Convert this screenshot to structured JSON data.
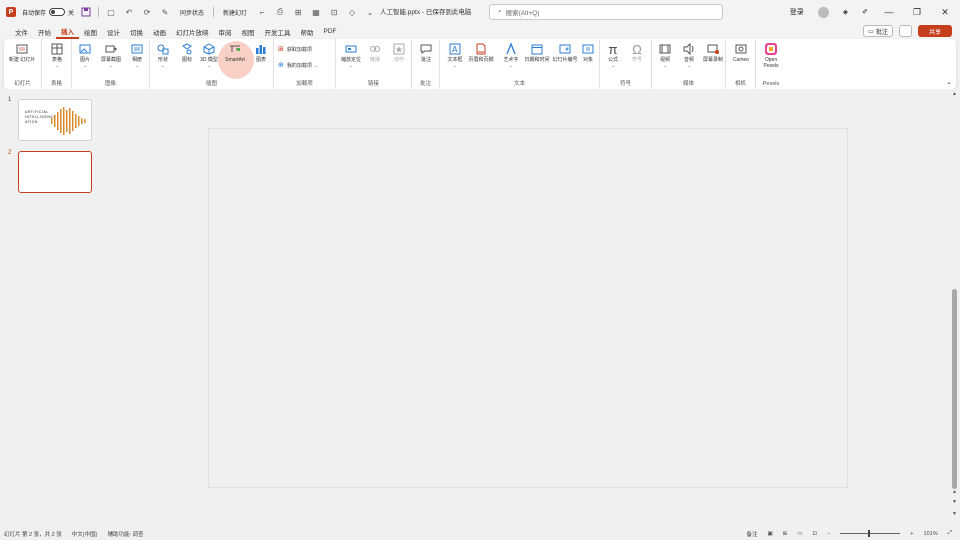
{
  "titlebar": {
    "autosave_label": "自动保存",
    "autosave_state": "关",
    "quick_text_1": "同步状态",
    "quick_text_2": "新建幻灯",
    "filename": "人工智能.pptx - 已保存到此电脑",
    "search_placeholder": "搜索(Alt+Q)",
    "user_name": "登录"
  },
  "menu": {
    "tabs": [
      "文件",
      "开始",
      "插入",
      "绘图",
      "设计",
      "切换",
      "动画",
      "幻灯片放映",
      "审阅",
      "视图",
      "开发工具",
      "帮助",
      "PDF"
    ],
    "active_index": 2,
    "comment_label": "批注",
    "share_label": "共享"
  },
  "ribbon": {
    "groups": [
      {
        "label": "幻灯片",
        "buttons": [
          {
            "label": "新建\n幻灯片"
          }
        ]
      },
      {
        "label": "表格",
        "buttons": [
          {
            "label": "表格"
          }
        ]
      },
      {
        "label": "图像",
        "buttons": [
          {
            "label": "图片"
          },
          {
            "label": "屏幕截图"
          },
          {
            "label": "相册"
          }
        ]
      },
      {
        "label": "插图",
        "buttons": [
          {
            "label": "形状"
          },
          {
            "label": "图标"
          },
          {
            "label": "3D 模型"
          },
          {
            "label": "SmartArt"
          },
          {
            "label": "图表"
          }
        ]
      },
      {
        "label": "加载项",
        "buttons": [
          {
            "label": "获取加载项"
          },
          {
            "label": "我的加载项"
          }
        ]
      },
      {
        "label": "链接",
        "buttons": [
          {
            "label": "缩放定位"
          },
          {
            "label": "链接"
          },
          {
            "label": "动作"
          }
        ]
      },
      {
        "label": "批注",
        "buttons": [
          {
            "label": "批注"
          }
        ]
      },
      {
        "label": "文本",
        "buttons": [
          {
            "label": "文本框"
          },
          {
            "label": "页眉和页脚"
          },
          {
            "label": "艺术字"
          },
          {
            "label": "日期和时间"
          },
          {
            "label": "幻灯片编号"
          },
          {
            "label": "对象"
          }
        ]
      },
      {
        "label": "符号",
        "buttons": [
          {
            "label": "公式"
          },
          {
            "label": "符号"
          }
        ]
      },
      {
        "label": "媒体",
        "buttons": [
          {
            "label": "视频"
          },
          {
            "label": "音频"
          },
          {
            "label": "屏幕录制"
          }
        ]
      },
      {
        "label": "相机",
        "buttons": [
          {
            "label": "Cameo"
          }
        ]
      },
      {
        "label": "Pexels",
        "buttons": [
          {
            "label": "Open\nPexels"
          }
        ]
      }
    ]
  },
  "thumbnails": [
    {
      "number": "1",
      "text": "ARTIFICIAL\nINTELLIGENCE\nATION"
    },
    {
      "number": "2",
      "text": ""
    }
  ],
  "statusbar": {
    "slide_info": "幻灯片 第 2 张，共 2 张",
    "language": "中文(中国)",
    "accessibility": "辅助功能: 调查",
    "notes": "备注",
    "zoom": "101%"
  },
  "colors": {
    "accent": "#c43e1c",
    "highlight": "#f4aa96"
  }
}
